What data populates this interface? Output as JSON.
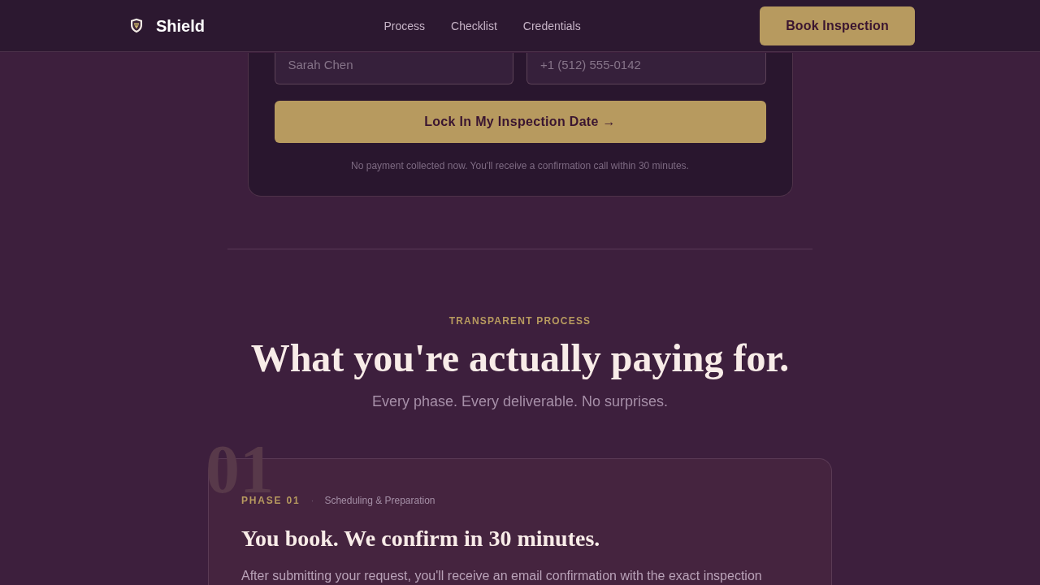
{
  "header": {
    "brand": "Shield",
    "nav": [
      {
        "label": "Process"
      },
      {
        "label": "Checklist"
      },
      {
        "label": "Credentials"
      }
    ],
    "cta": "Book Inspection"
  },
  "booking_form": {
    "fields": [
      {
        "placeholder": "Sarah Chen"
      },
      {
        "placeholder": "+1 (512) 555-0142"
      }
    ],
    "submit": "Lock In My Inspection Date →",
    "note": "No payment collected now. You'll receive a confirmation call within 30 minutes."
  },
  "process": {
    "eyebrow": "TRANSPARENT PROCESS",
    "title": "What you're actually paying for.",
    "subtitle": "Every phase. Every deliverable. No surprises.",
    "phases": [
      {
        "number": "01",
        "label": "PHASE 01",
        "separator": "·",
        "name": "Scheduling & Preparation",
        "title": "You book. We confirm in 30 minutes.",
        "body": "After submitting your request, you'll receive an email confirmation with the exact inspection"
      }
    ]
  }
}
